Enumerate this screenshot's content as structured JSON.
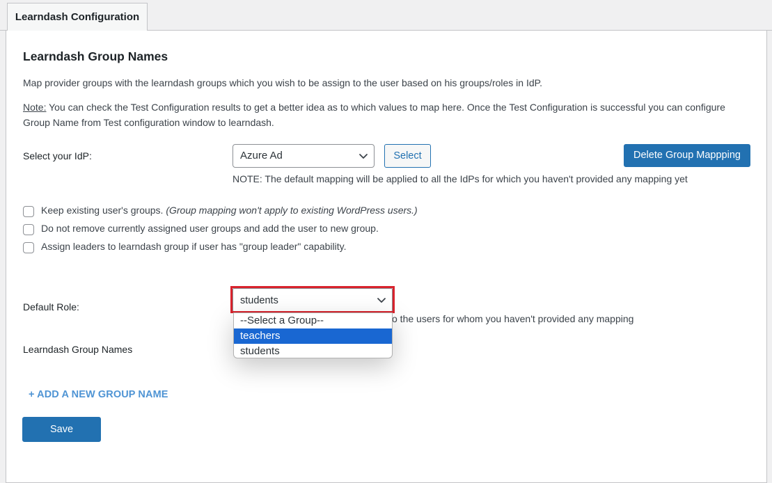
{
  "tab": {
    "label": "Learndash Configuration"
  },
  "section": {
    "title": "Learndash Group Names",
    "description": "Map provider groups with the learndash groups which you wish to be assign to the user based on his groups/roles in IdP.",
    "note_label": "Note:",
    "note_line1": " You can check the Test Configuration results to get a better idea as to which values to map here. Once the Test Configuration is successful you can configure",
    "note_line2": "Group Name from Test configuration window to learndash."
  },
  "idp": {
    "label": "Select your IdP:",
    "selected": "Azure Ad",
    "select_button": "Select",
    "delete_button": "Delete Group Mappping",
    "note": "NOTE: The default mapping will be applied to all the IdPs for which you haven't provided any mapping yet"
  },
  "options": [
    {
      "label": "Keep existing user's groups. ",
      "hint": "(Group mapping won't apply to existing WordPress users.)",
      "checked": false
    },
    {
      "label": "Do not remove currently assigned user groups and add the user to new group.",
      "hint": "",
      "checked": false
    },
    {
      "label": "Assign leaders to learndash group if user has \"group leader\" capability.",
      "hint": "",
      "checked": false
    }
  ],
  "default_role": {
    "label": "Default Role:",
    "selected": "students",
    "hint_visible": "o the users for whom you haven't provided any mapping",
    "dropdown_options": [
      "--Select a Group--",
      "teachers",
      "students"
    ],
    "highlighted_index": 1
  },
  "group_names": {
    "label": "Learndash Group Names"
  },
  "add_group": {
    "label": "+ ADD A NEW GROUP NAME"
  },
  "save": {
    "label": "Save"
  },
  "colors": {
    "primary": "#2271b1",
    "highlight_border": "#d9232d",
    "dropdown_selected": "#1967d2",
    "link": "#4f94d4"
  }
}
